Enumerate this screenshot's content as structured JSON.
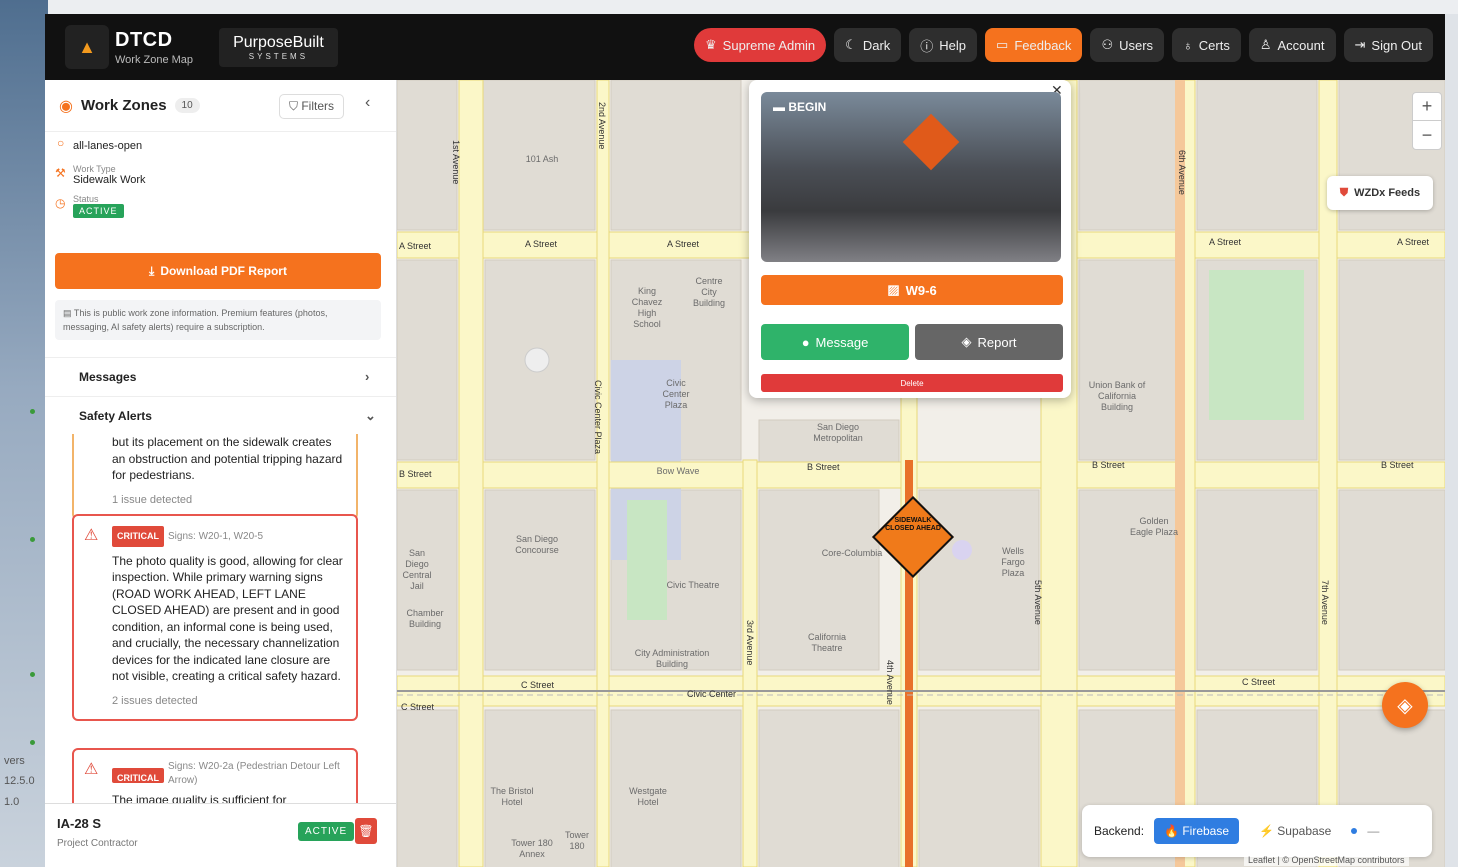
{
  "desktop": {
    "left_labels": [
      "vers",
      "12.5.0",
      "1.0"
    ]
  },
  "header": {
    "app_title": "DTCD",
    "app_subtitle": "Work Zone Map",
    "partner_title": "PurposeBuilt",
    "partner_subtitle": "SYSTEMS",
    "buttons": [
      {
        "label": "Supreme Admin",
        "icon": "crown-icon"
      },
      {
        "label": "Dark",
        "icon": "moon-icon"
      },
      {
        "label": "Help",
        "icon": "help-icon"
      },
      {
        "label": "Feedback",
        "icon": "chat-icon"
      },
      {
        "label": "Users",
        "icon": "users-icon"
      },
      {
        "label": "Certs",
        "icon": "award-icon"
      },
      {
        "label": "Account",
        "icon": "user-icon"
      },
      {
        "label": "Sign Out",
        "icon": "sign-out-icon"
      }
    ]
  },
  "sidebar": {
    "title": "Work Zones",
    "count": "10",
    "filters_label": "Filters",
    "lanes_value": "all-lanes-open",
    "work_type_label": "Work Type",
    "work_type_value": "Sidewalk Work",
    "status_label": "Status",
    "status_value": "ACTIVE",
    "download_label": "Download PDF Report",
    "notice": "This is public work zone information. Premium features (photos, messaging, AI safety alerts) require a subscription.",
    "messages_label": "Messages",
    "safety_alerts_label": "Safety Alerts",
    "alerts": [
      {
        "text": "but its placement on the sidewalk creates an obstruction and potential tripping hazard for pedestrians.",
        "issues": "1 issue detected"
      },
      {
        "severity": "CRITICAL",
        "signs": "Signs: W20-1, W20-5",
        "text": "The photo quality is good, allowing for clear inspection. While primary warning signs (ROAD WORK AHEAD, LEFT LANE CLOSED AHEAD) are present and in good condition, an informal cone is being used, and crucially, the necessary channelization devices for the indicated lane closure are not visible, creating a critical safety hazard.",
        "issues": "2 issues detected"
      },
      {
        "severity": "CRITICAL",
        "signs": "Signs: W20-2a (Pedestrian Detour Left Arrow)",
        "text": "The image quality is sufficient for"
      }
    ],
    "footer": {
      "name": "IA-28 S",
      "subtitle": "Project Contractor",
      "status": "ACTIVE"
    }
  },
  "popup": {
    "photo_label": "BEGIN",
    "sign_code": "W9-6",
    "message_label": "Message",
    "report_label": "Report",
    "delete_label": "Delete"
  },
  "map": {
    "streets": [
      "A Street",
      "A Street",
      "A Street",
      "A Street",
      "A Street",
      "B Street",
      "B Street",
      "B Street",
      "B Street",
      "C Street",
      "C Street",
      "C Street"
    ],
    "avenues": [
      "1st Avenue",
      "2nd Avenue",
      "3rd Avenue",
      "4th Avenue",
      "5th Avenue",
      "6th Avenue",
      "7th Avenue",
      "Civic Center Plaza",
      "Civic Center"
    ],
    "places": [
      "101 Ash",
      "King Chavez High School",
      "Centre City Building",
      "Civic Center Plaza",
      "Bow Wave",
      "San Diego Concourse",
      "Civic Theatre",
      "City Administration Building",
      "Core-Columbia",
      "California Theatre",
      "Union Bank of California Building",
      "Golden Eagle Plaza",
      "Wells Fargo Plaza",
      "San Diego Central Jail",
      "Chamber Building",
      "The Bristol Hotel",
      "Westgate Hotel",
      "Tower 180 Annex",
      "Tower 180",
      "San Diego Metropolitan"
    ],
    "marker_text": "SIDEWALK CLOSED AHEAD",
    "wzdx_label": "WZDx Feeds",
    "backend_label": "Backend:",
    "backend_options": [
      "Firebase",
      "Supabase"
    ],
    "attribution": "Leaflet | © OpenStreetMap contributors"
  }
}
